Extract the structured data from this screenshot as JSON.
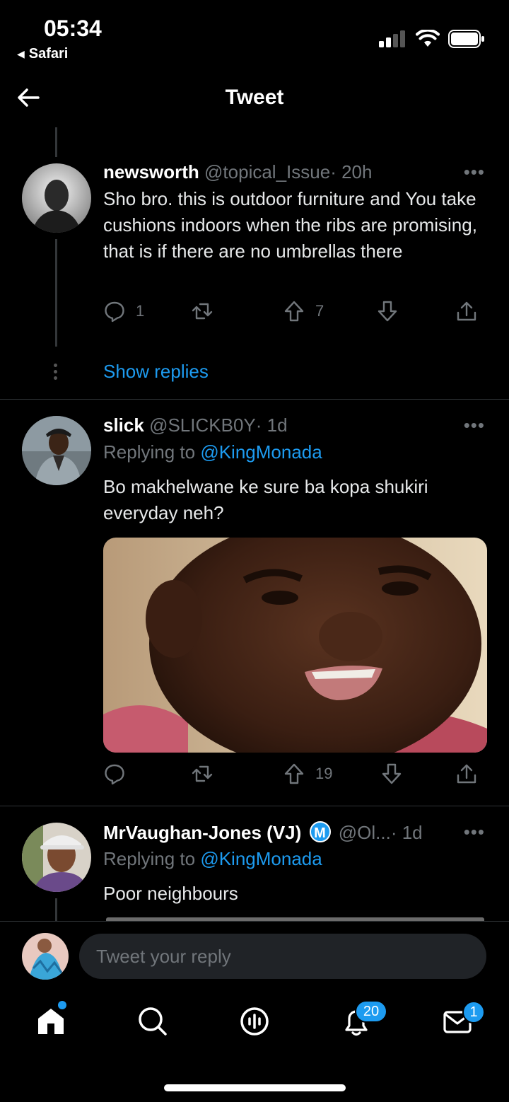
{
  "status_bar": {
    "time": "05:34",
    "back_app": "Safari"
  },
  "header": {
    "title": "Tweet"
  },
  "tweets": [
    {
      "name": "newsworth",
      "handle": "@topical_Issue",
      "time": "· 20h",
      "text": "Sho bro.  this is outdoor furniture and  You take cushions indoors when the ribs are promising, that is if there are no umbrellas there",
      "replies": "1",
      "upvotes": "7"
    },
    {
      "name": "slick",
      "handle": "@SLICKB0Y",
      "time": "· 1d",
      "replying_prefix": "Replying to ",
      "replying_to": "@KingMonada",
      "text": "Bo makhelwane ke sure ba kopa shukiri everyday neh?",
      "upvotes": "19"
    },
    {
      "name": "MrVaughan-Jones (VJ)",
      "badge": "M",
      "handle": "@Ol...",
      "time": "· 1d",
      "replying_prefix": "Replying to ",
      "replying_to": "@KingMonada",
      "text": "Poor neighbours"
    }
  ],
  "show_replies": "Show replies",
  "more_label": "•••",
  "composer": {
    "placeholder": "Tweet your reply"
  },
  "tabbar": {
    "notifications_count": "20",
    "messages_count": "1"
  },
  "colors": {
    "accent": "#1d9bf0",
    "background": "#000000",
    "muted": "#71767b"
  }
}
